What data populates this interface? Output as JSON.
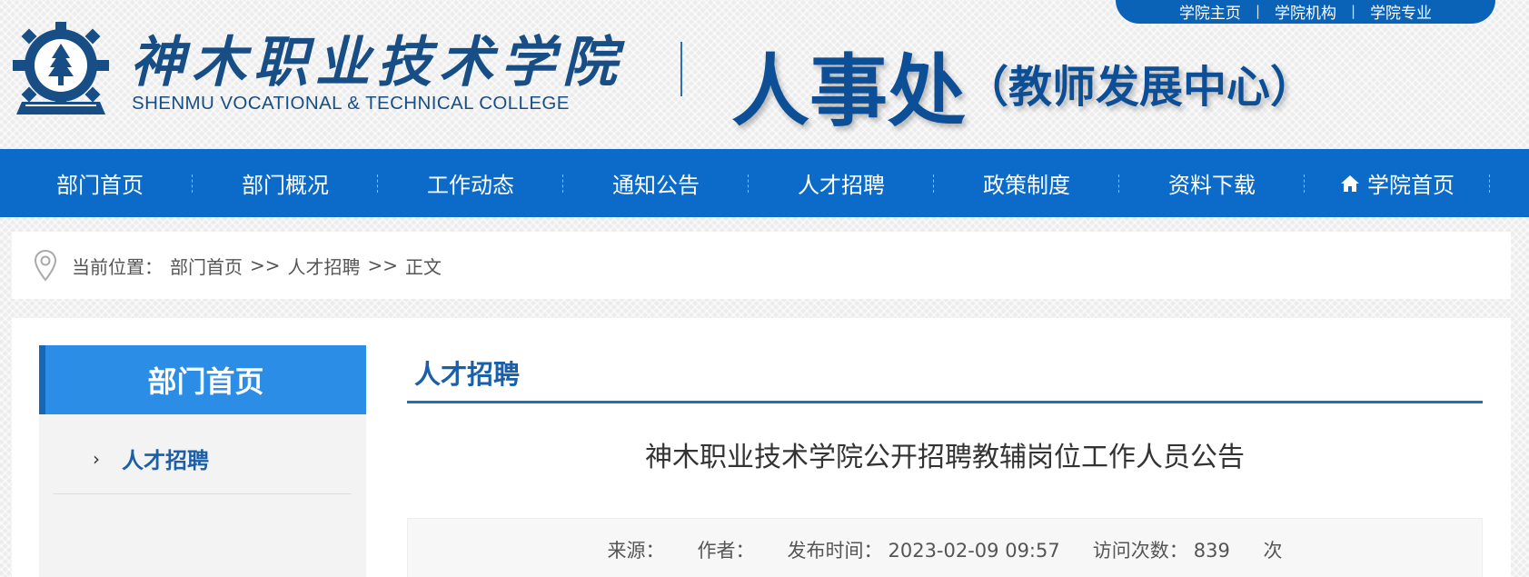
{
  "top_links": [
    "学院主页",
    "学院机构",
    "学院专业"
  ],
  "logo": {
    "emblem_icon": "college-gear-emblem-icon",
    "name_cn": "神木职业技术学院",
    "name_en": "SHENMU VOCATIONAL & TECHNICAL COLLEGE"
  },
  "department": {
    "title": "人事处",
    "subtitle": "（教师发展中心）"
  },
  "nav": [
    {
      "label": "部门首页"
    },
    {
      "label": "部门概况"
    },
    {
      "label": "工作动态"
    },
    {
      "label": "通知公告"
    },
    {
      "label": "人才招聘"
    },
    {
      "label": "政策制度"
    },
    {
      "label": "资料下载"
    },
    {
      "label": "学院首页",
      "icon": "home-icon"
    }
  ],
  "breadcrumb": {
    "icon": "location-pin-icon",
    "label": "当前位置：",
    "items": [
      "部门首页",
      "人才招聘",
      "正文"
    ],
    "separator": ">>"
  },
  "sidebar": {
    "title": "部门首页",
    "items": [
      {
        "label": "人才招聘",
        "icon": "chevron-right-icon"
      }
    ]
  },
  "main": {
    "section_title": "人才招聘",
    "article_title": "神木职业技术学院公开招聘教辅岗位工作人员公告",
    "meta": {
      "source_label": "来源：",
      "source_value": "",
      "author_label": "作者：",
      "author_value": "",
      "date_label": "发布时间：",
      "date_value": "2023-02-09 09:57",
      "views_label": "访问次数：",
      "views_value": "839",
      "views_unit": "次"
    }
  },
  "colors": {
    "brand_blue": "#0c6bc9",
    "logo_blue": "#184e86",
    "sidebar_blue": "#2b8de6",
    "link_blue": "#1a5fa8"
  }
}
